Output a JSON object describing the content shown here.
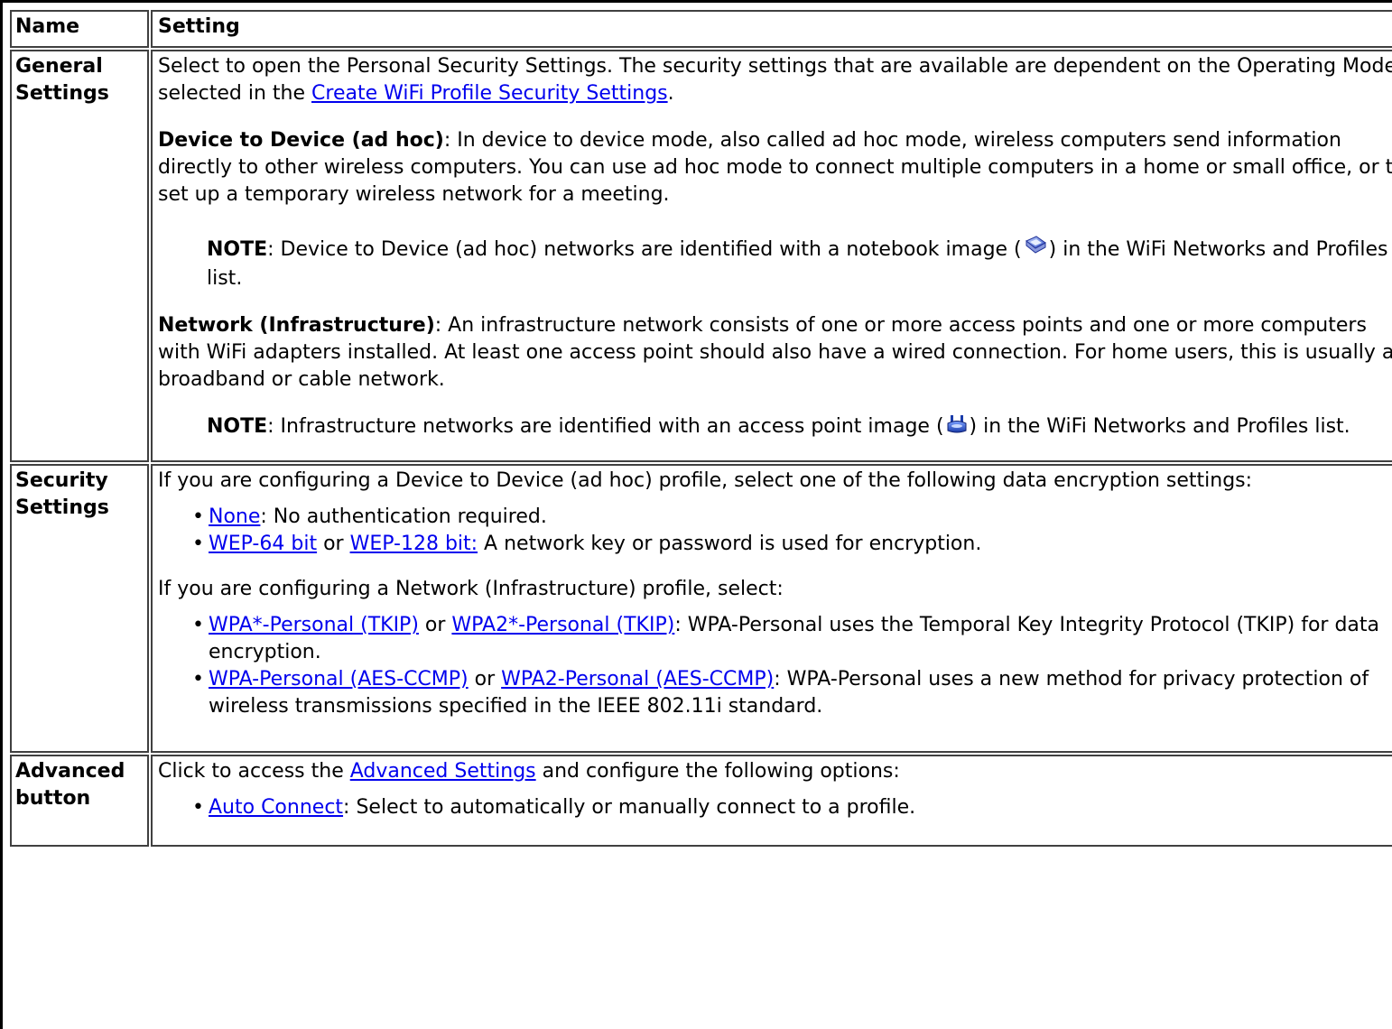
{
  "header": {
    "name_label": "Name",
    "setting_label": "Setting"
  },
  "rows": {
    "general": {
      "name_line1": "General",
      "name_line2": "Settings",
      "intro_text": "Select to open the Personal Security Settings. The security settings that are available are dependent on the Operating Mode selected in the ",
      "intro_link": "Create WiFi Profile Security Settings",
      "intro_end": ".",
      "adhoc_title": "Device to Device (ad hoc)",
      "adhoc_text": ": In device to device mode, also called ad hoc mode, wireless computers send information directly to other wireless computers. You can use ad hoc mode to connect multiple computers in a home or small office, or to set up a temporary wireless network for a meeting.",
      "note1_label": "NOTE",
      "note1_text_a": ": Device to Device (ad hoc) networks are identified with a notebook image (",
      "note1_text_b": ") in the WiFi Networks and Profiles list.",
      "infra_title": "Network (Infrastructure)",
      "infra_text": ": An infrastructure network consists of one or more access points and one or more computers with WiFi adapters installed. At least one access point should also have a wired connection. For home users, this is usually a broadband or cable network.",
      "note2_label": "NOTE",
      "note2_text_a": ": Infrastructure networks are identified with an access point image (",
      "note2_text_b": ") in the WiFi Networks and Profiles list."
    },
    "security": {
      "name_line1": "Security",
      "name_line2": "Settings",
      "adhoc_intro": "If you are configuring a Device to Device (ad hoc) profile, select one of the following data encryption settings:",
      "adhoc_items": [
        {
          "link1": "None",
          "mid": "",
          "link2": "",
          "text": ": No authentication required."
        },
        {
          "link1": "WEP-64 bit",
          "mid": " or ",
          "link2": "WEP-128 bit:",
          "text": " A network key or password is used for encryption."
        }
      ],
      "infra_intro": "If you are configuring a Network (Infrastructure) profile, select:",
      "infra_items": [
        {
          "link1": "WPA*-Personal (TKIP)",
          "mid": " or ",
          "link2": "WPA2*-Personal (TKIP)",
          "text": ": WPA-Personal uses the Temporal Key Integrity Protocol (TKIP) for data encryption."
        },
        {
          "link1": "WPA-Personal (AES-CCMP)",
          "mid": " or ",
          "link2": "WPA2-Personal (AES-CCMP)",
          "text": ": WPA-Personal uses a new method for privacy protection of wireless transmissions specified in the IEEE 802.11i standard."
        }
      ]
    },
    "advanced": {
      "name_line1": "Advanced",
      "name_line2": "button",
      "intro_a": "Click to access the ",
      "intro_link": "Advanced Settings",
      "intro_b": " and configure the following options:",
      "items": [
        {
          "link1": "Auto Connect",
          "text": ": Select to automatically or manually connect to a profile."
        }
      ]
    }
  },
  "colors": {
    "link": "#0000ee",
    "border": "#404040"
  },
  "icons": {
    "bullet": "•",
    "notebook": "notebook-icon",
    "access_point": "access-point-icon"
  }
}
